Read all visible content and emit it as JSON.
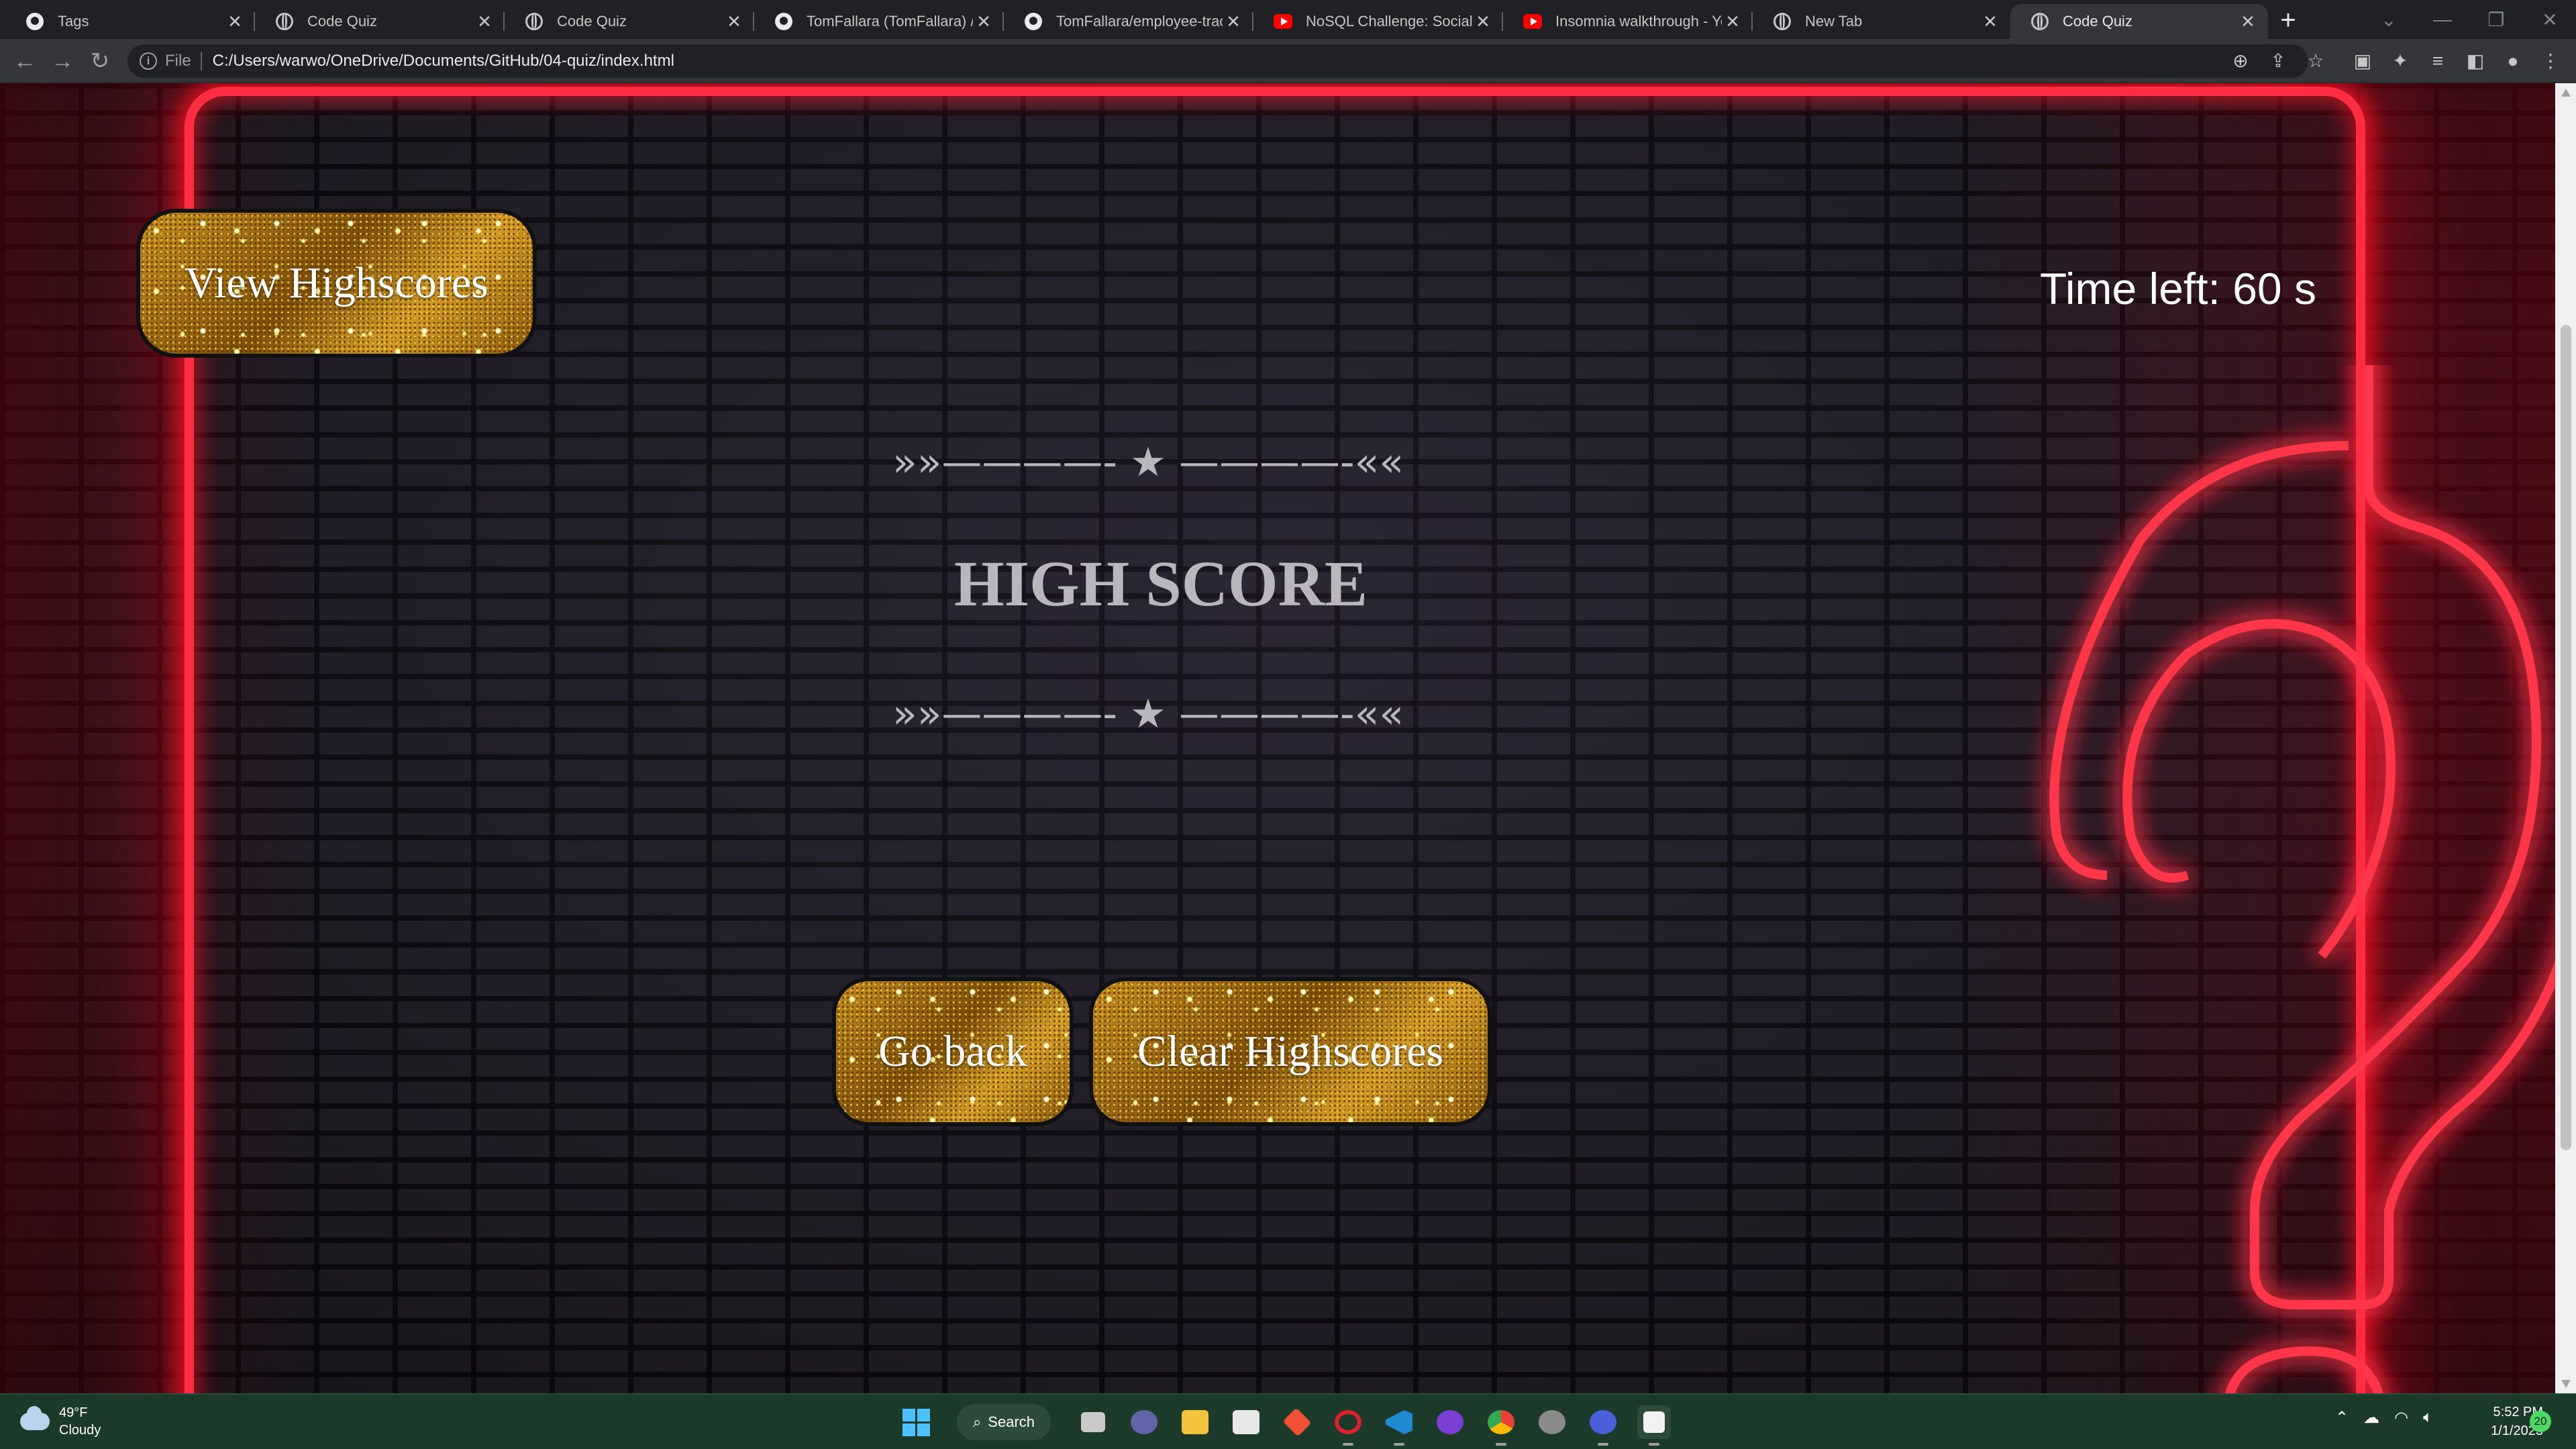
{
  "browser": {
    "tabs": [
      {
        "title": "Tags",
        "icon": "github-icon"
      },
      {
        "title": "Code Quiz",
        "icon": "globe-icon"
      },
      {
        "title": "Code Quiz",
        "icon": "globe-icon"
      },
      {
        "title": "TomFallara (TomFallara) / Re",
        "icon": "github-icon"
      },
      {
        "title": "TomFallara/employee-tracke",
        "icon": "github-icon"
      },
      {
        "title": "NoSQL Challenge: Social Ne",
        "icon": "youtube-icon"
      },
      {
        "title": "Insomnia walkthrough - You",
        "icon": "youtube-icon"
      },
      {
        "title": "New Tab",
        "icon": "chrome-icon"
      },
      {
        "title": "Code Quiz",
        "icon": "globe-icon",
        "active": true
      }
    ],
    "address": {
      "scheme_label": "File",
      "url": "C:/Users/warwo/OneDrive/Documents/GitHub/04-quiz/index.html"
    }
  },
  "page": {
    "view_highscores_label": "View Highscores",
    "timer_text": "Time left: 60 s",
    "divider_text": "»»————- ★ ————-««",
    "title": "HIGH SCORE",
    "go_back_label": "Go back",
    "clear_label": "Clear Highscores"
  },
  "taskbar": {
    "weather": {
      "temp": "49°F",
      "condition": "Cloudy"
    },
    "search_label": "Search",
    "clock": {
      "time": "5:52 PM",
      "date": "1/1/2023"
    },
    "notification_count": "20"
  },
  "colors": {
    "neon_red": "#ff2d3f",
    "glitter_gold": "#c68d1c",
    "heading_gray": "#b9b6bd",
    "tab_bar": "#202124",
    "taskbar": "#1c3a2a"
  }
}
